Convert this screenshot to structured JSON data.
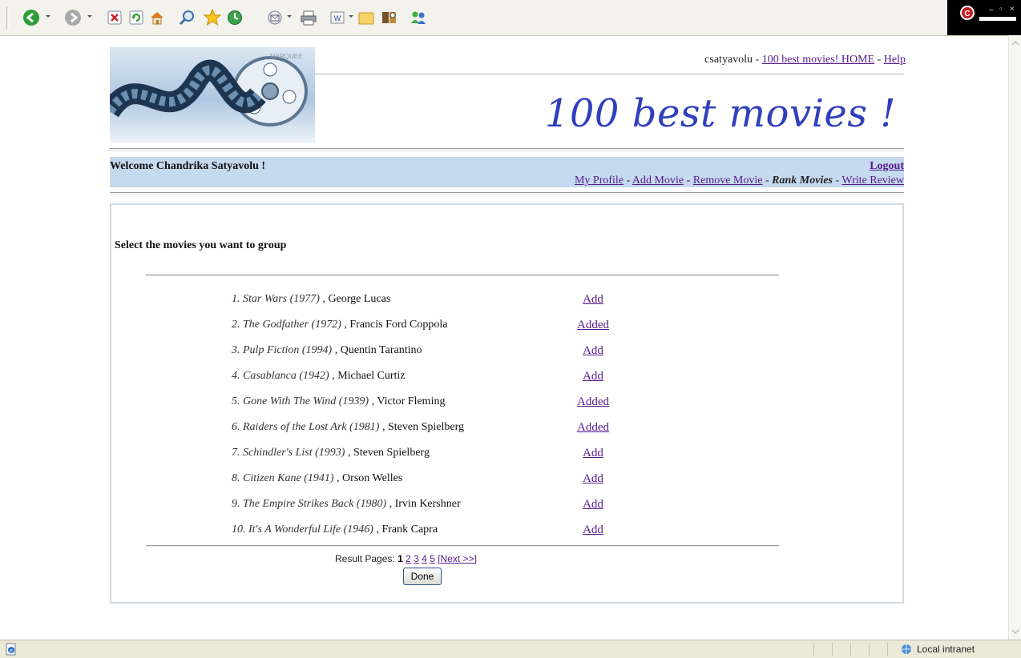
{
  "toolbar": {
    "icons": [
      "back-icon",
      "forward-icon",
      "stop-icon",
      "refresh-icon",
      "home-icon",
      "search-icon",
      "favorites-icon",
      "history-icon",
      "mail-icon",
      "print-icon",
      "edit-icon",
      "folder-icon",
      "research-icon",
      "messenger-icon"
    ]
  },
  "header": {
    "user": "csatyavolu",
    "home_link": "100 best movies! HOME",
    "help_link": "Help",
    "site_title": "100 best movies !"
  },
  "welcome": {
    "text": "Welcome Chandrika Satyavolu !",
    "logout": "Logout"
  },
  "nav": {
    "my_profile": "My Profile",
    "add_movie": "Add Movie",
    "remove_movie": "Remove Movie",
    "rank_movies": "Rank Movies",
    "write_review": "Write Review"
  },
  "main": {
    "prompt": "Select the movies you want to group",
    "movies": [
      {
        "num": "1.",
        "title": "Star Wars (1977)",
        "director": "George Lucas",
        "action": "Add"
      },
      {
        "num": "2.",
        "title": "The Godfather (1972)",
        "director": "Francis Ford Coppola",
        "action": "Added"
      },
      {
        "num": "3.",
        "title": "Pulp Fiction (1994)",
        "director": "Quentin Tarantino",
        "action": "Add"
      },
      {
        "num": "4.",
        "title": "Casablanca (1942)",
        "director": "Michael Curtiz",
        "action": "Add"
      },
      {
        "num": "5.",
        "title": "Gone With The Wind (1939)",
        "director": "Victor Fleming",
        "action": "Added"
      },
      {
        "num": "6.",
        "title": "Raiders of the Lost Ark (1981)",
        "director": "Steven Spielberg",
        "action": "Added"
      },
      {
        "num": "7.",
        "title": "Schindler's List (1993)",
        "director": "Steven Spielberg",
        "action": "Add"
      },
      {
        "num": "8.",
        "title": "Citizen Kane (1941)",
        "director": "Orson Welles",
        "action": "Add"
      },
      {
        "num": "9.",
        "title": "The Empire Strikes Back (1980)",
        "director": "Irvin Kershner",
        "action": "Add"
      },
      {
        "num": "10.",
        "title": "It's A Wonderful Life (1946)",
        "director": "Frank Capra",
        "action": "Add"
      }
    ],
    "pager": {
      "label": "Result Pages:",
      "current": "1",
      "pages": [
        "2",
        "3",
        "4",
        "5"
      ],
      "next": "[Next >>]"
    },
    "done_button": "Done"
  },
  "status": {
    "zone": "Local intranet"
  },
  "colors": {
    "link": "#551a8b",
    "title": "#2f3fbe",
    "welcome_bar": "#c5d9ef"
  }
}
